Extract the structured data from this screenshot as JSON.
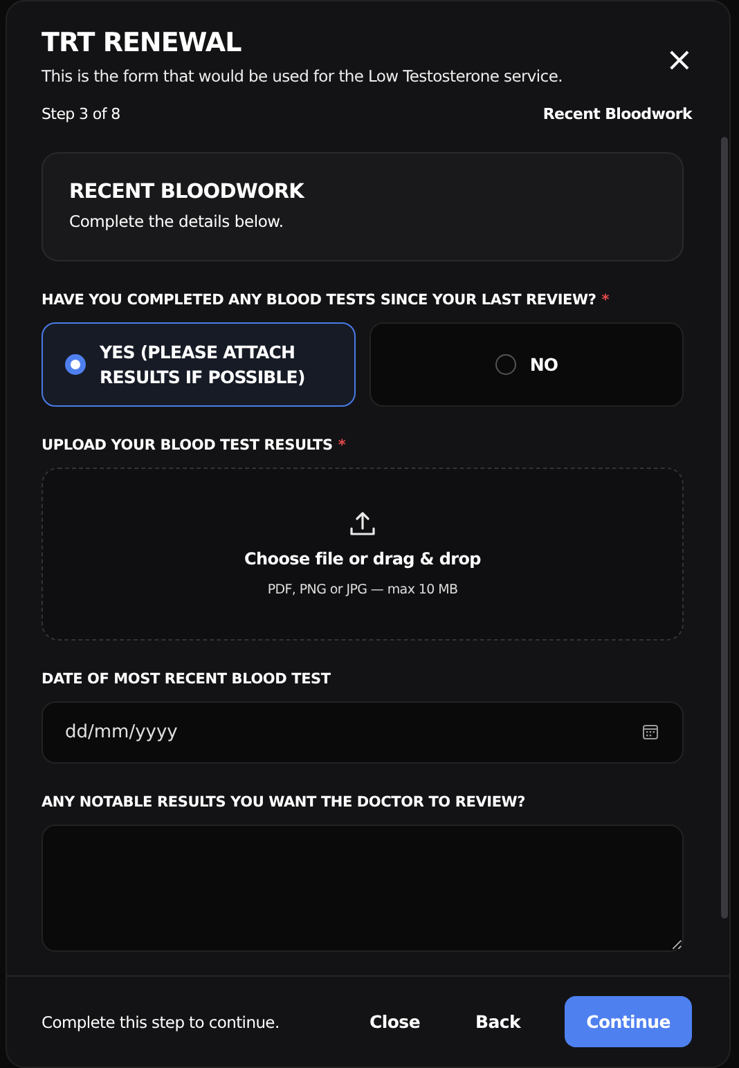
{
  "modal": {
    "title": "TRT RENEWAL",
    "subtitle": "This is the form that would be used for the Low Testosterone service.",
    "close_icon": "×"
  },
  "progress": {
    "step": "Step 3 of 8",
    "section_name": "Recent Bloodwork"
  },
  "section": {
    "title": "RECENT BLOODWORK",
    "description": "Complete the details below."
  },
  "question": {
    "label": "HAVE YOU COMPLETED ANY BLOOD TESTS SINCE YOUR LAST REVIEW?",
    "required_mark": "*",
    "options": [
      {
        "label": "YES (PLEASE ATTACH RESULTS IF POSSIBLE)",
        "selected": true
      },
      {
        "label": "NO",
        "selected": false
      }
    ]
  },
  "upload": {
    "label": "UPLOAD YOUR BLOOD TEST RESULTS",
    "required_mark": "*",
    "prompt": "Choose file or drag & drop",
    "hint": "PDF, PNG or JPG — max 10 MB"
  },
  "date": {
    "label": "DATE OF MOST RECENT BLOOD TEST",
    "placeholder": "dd/mm/yyyy"
  },
  "notes": {
    "label": "ANY NOTABLE RESULTS YOU WANT THE DOCTOR TO REVIEW?"
  },
  "footer": {
    "status": "Complete this step to continue.",
    "buttons": [
      {
        "label": "Close",
        "kind": "plain"
      },
      {
        "label": "Back",
        "kind": "plain"
      },
      {
        "label": "Continue",
        "kind": "primary"
      }
    ]
  }
}
